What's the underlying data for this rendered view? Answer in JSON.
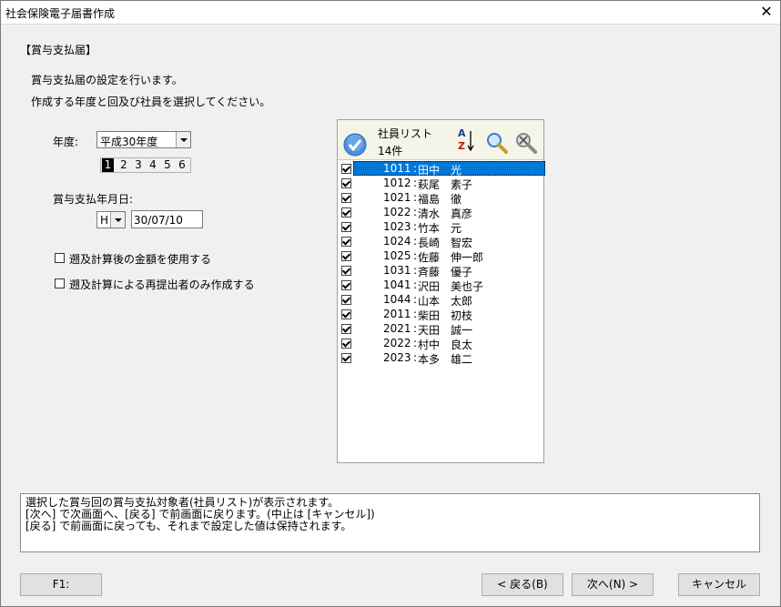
{
  "window": {
    "title": "社会保険電子届書作成",
    "close_glyph": "✕"
  },
  "section_title": "【賞与支払届】",
  "description": [
    "賞与支払届の設定を行います。",
    "作成する年度と回及び社員を選択してください。"
  ],
  "year": {
    "label": "年度:",
    "value": "平成30年度"
  },
  "rounds": {
    "items": [
      "1",
      "2",
      "3",
      "4",
      "5",
      "6"
    ],
    "selected": "1"
  },
  "payment_date": {
    "label": "賞与支払年月日:",
    "era": "H",
    "date": "30/07/10"
  },
  "options": [
    {
      "label": "遡及計算後の金額を使用する",
      "checked": false
    },
    {
      "label": "遡及計算による再提出者のみ作成する",
      "checked": false
    }
  ],
  "employee_list": {
    "title": "社員リスト",
    "count": "14件",
    "sort_icon_text": {
      "a": "A",
      "z": "Z"
    },
    "rows": [
      {
        "code": "1011",
        "name": "田中　光",
        "checked": true,
        "selected": true
      },
      {
        "code": "1012",
        "name": "萩尾　素子",
        "checked": true
      },
      {
        "code": "1021",
        "name": "福島　徹",
        "checked": true
      },
      {
        "code": "1022",
        "name": "清水　真彦",
        "checked": true
      },
      {
        "code": "1023",
        "name": "竹本　元",
        "checked": true
      },
      {
        "code": "1024",
        "name": "長崎　智宏",
        "checked": true
      },
      {
        "code": "1025",
        "name": "佐藤　伸一郎",
        "checked": true
      },
      {
        "code": "1031",
        "name": "斉藤　優子",
        "checked": true
      },
      {
        "code": "1041",
        "name": "沢田　美也子",
        "checked": true
      },
      {
        "code": "1044",
        "name": "山本　太郎",
        "checked": true
      },
      {
        "code": "2011",
        "name": "柴田　初枝",
        "checked": true
      },
      {
        "code": "2021",
        "name": "天田　誠一",
        "checked": true
      },
      {
        "code": "2022",
        "name": "村中　良太",
        "checked": true
      },
      {
        "code": "2023",
        "name": "本多　雄二",
        "checked": true
      }
    ]
  },
  "message_lines": [
    "選択した賞与回の賞与支払対象者(社員リスト)が表示されます。",
    "[次へ] で次画面へ、[戻る] で前画面に戻ります。(中止は [キャンセル])",
    "[戻る] で前画面に戻っても、それまで設定した値は保持されます。"
  ],
  "buttons": {
    "f1": "F1:",
    "back": "< 戻る(B)",
    "next": "次へ(N) >",
    "cancel": "キャンセル"
  },
  "colors": {
    "selection": "#0078d7",
    "check_icon": "#4a8fdc"
  }
}
